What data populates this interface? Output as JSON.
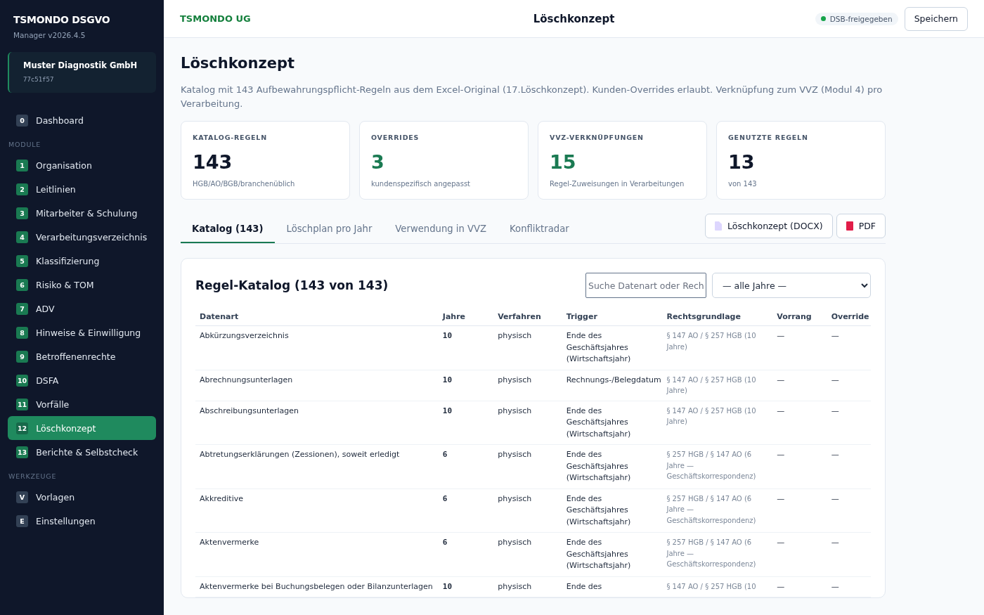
{
  "brand": {
    "title": "TSMONDO DSGVO",
    "version": "Manager v2026.4.5"
  },
  "client": {
    "name": "Muster Diagnostik GmbH",
    "id": "77c51f57"
  },
  "nav": [
    {
      "kind": "tool",
      "badge": "0",
      "label": "Dashboard",
      "selected": false
    },
    {
      "kind": "section",
      "label": "MODULE"
    },
    {
      "kind": "module",
      "badge": "1",
      "label": "Organisation",
      "selected": false
    },
    {
      "kind": "module",
      "badge": "2",
      "label": "Leitlinien",
      "selected": false
    },
    {
      "kind": "module",
      "badge": "3",
      "label": "Mitarbeiter & Schulung",
      "selected": false
    },
    {
      "kind": "module",
      "badge": "4",
      "label": "Verarbeitungsverzeichnis",
      "selected": false
    },
    {
      "kind": "module",
      "badge": "5",
      "label": "Klassifizierung",
      "selected": false
    },
    {
      "kind": "module",
      "badge": "6",
      "label": "Risiko & TOM",
      "selected": false
    },
    {
      "kind": "module",
      "badge": "7",
      "label": "ADV",
      "selected": false
    },
    {
      "kind": "module",
      "badge": "8",
      "label": "Hinweise & Einwilligung",
      "selected": false
    },
    {
      "kind": "module",
      "badge": "9",
      "label": "Betroffenenrechte",
      "selected": false
    },
    {
      "kind": "module",
      "badge": "10",
      "label": "DSFA",
      "selected": false
    },
    {
      "kind": "module",
      "badge": "11",
      "label": "Vorfälle",
      "selected": false
    },
    {
      "kind": "module",
      "badge": "12",
      "label": "Löschkonzept",
      "selected": true
    },
    {
      "kind": "module",
      "badge": "13",
      "label": "Berichte & Selbstcheck",
      "selected": false
    },
    {
      "kind": "section",
      "label": "WERKZEUGE"
    },
    {
      "kind": "tool",
      "badge": "V",
      "label": "Vorlagen",
      "selected": false
    },
    {
      "kind": "tool",
      "badge": "E",
      "label": "Einstellungen",
      "selected": false
    }
  ],
  "topbar": {
    "company": "TSMONDO UG",
    "title": "Löschkonzept",
    "status": {
      "label": "DSB-freigegeben",
      "color": "#16a34a"
    },
    "save": "Speichern"
  },
  "page": {
    "title": "Löschkonzept",
    "description": "Katalog mit 143 Aufbewahrungspflicht-Regeln aus dem Excel-Original (17.Löschkonzept). Kunden-Overrides erlaubt. Verknüpfung zum VVZ (Modul 4) pro Verarbeitung."
  },
  "stats": [
    {
      "label": "KATALOG-REGELN",
      "value": "143",
      "note": "HGB/AO/BGB/branchenüblich",
      "accent": false
    },
    {
      "label": "OVERRIDES",
      "value": "3",
      "note": "kundenspezifisch angepasst",
      "accent": true
    },
    {
      "label": "VVZ-VERKNÜPFUNGEN",
      "value": "15",
      "note": "Regel-Zuweisungen in Verarbeitungen",
      "accent": true
    },
    {
      "label": "GENUTZTE REGELN",
      "value": "13",
      "note": "von 143",
      "accent": false
    }
  ],
  "tabs": [
    {
      "label": "Katalog (143)",
      "selected": true
    },
    {
      "label": "Löschplan pro Jahr",
      "selected": false
    },
    {
      "label": "Verwendung in VVZ",
      "selected": false
    },
    {
      "label": "Konfliktradar",
      "selected": false
    }
  ],
  "exports": [
    {
      "kind": "docx",
      "label": "Löschkonzept (DOCX)"
    },
    {
      "kind": "pdf",
      "label": "PDF"
    }
  ],
  "catalog": {
    "title": "Regel-Katalog (143 von 143)",
    "search": {
      "placeholder": "Suche Datenart oder Rech"
    },
    "year_filter": "— alle Jahre —",
    "columns": [
      "Datenart",
      "Jahre",
      "Verfahren",
      "Trigger",
      "Rechtsgrundlage",
      "Vorrang",
      "Override"
    ],
    "rows": [
      [
        "Abkürzungsverzeichnis",
        "10",
        "physisch",
        "Ende des Geschäftsjahres (Wirtschaftsjahr)",
        "§ 147 AO / § 257 HGB (10 Jahre)",
        "—",
        "—"
      ],
      [
        "Abrechnungsunterlagen",
        "10",
        "physisch",
        "Rechnungs-/Belegdatum",
        "§ 147 AO / § 257 HGB (10 Jahre)",
        "—",
        "—"
      ],
      [
        "Abschreibungsunterlagen",
        "10",
        "physisch",
        "Ende des Geschäftsjahres (Wirtschaftsjahr)",
        "§ 147 AO / § 257 HGB (10 Jahre)",
        "—",
        "—"
      ],
      [
        "Abtretungserklärungen (Zessionen), soweit erledigt",
        "6",
        "physisch",
        "Ende des Geschäftsjahres (Wirtschaftsjahr)",
        "§ 257 HGB / § 147 AO (6 Jahre — Geschäftskorrespondenz)",
        "—",
        "—"
      ],
      [
        "Akkreditive",
        "6",
        "physisch",
        "Ende des Geschäftsjahres (Wirtschaftsjahr)",
        "§ 257 HGB / § 147 AO (6 Jahre — Geschäftskorrespondenz)",
        "—",
        "—"
      ],
      [
        "Aktenvermerke",
        "6",
        "physisch",
        "Ende des Geschäftsjahres (Wirtschaftsjahr)",
        "§ 257 HGB / § 147 AO (6 Jahre — Geschäftskorrespondenz)",
        "—",
        "—"
      ],
      [
        "Aktenvermerke bei Buchungsbelegen oder Bilanzunterlagen",
        "10",
        "physisch",
        "Ende des",
        "§ 147 AO / § 257 HGB (10",
        "—",
        "—"
      ]
    ]
  }
}
